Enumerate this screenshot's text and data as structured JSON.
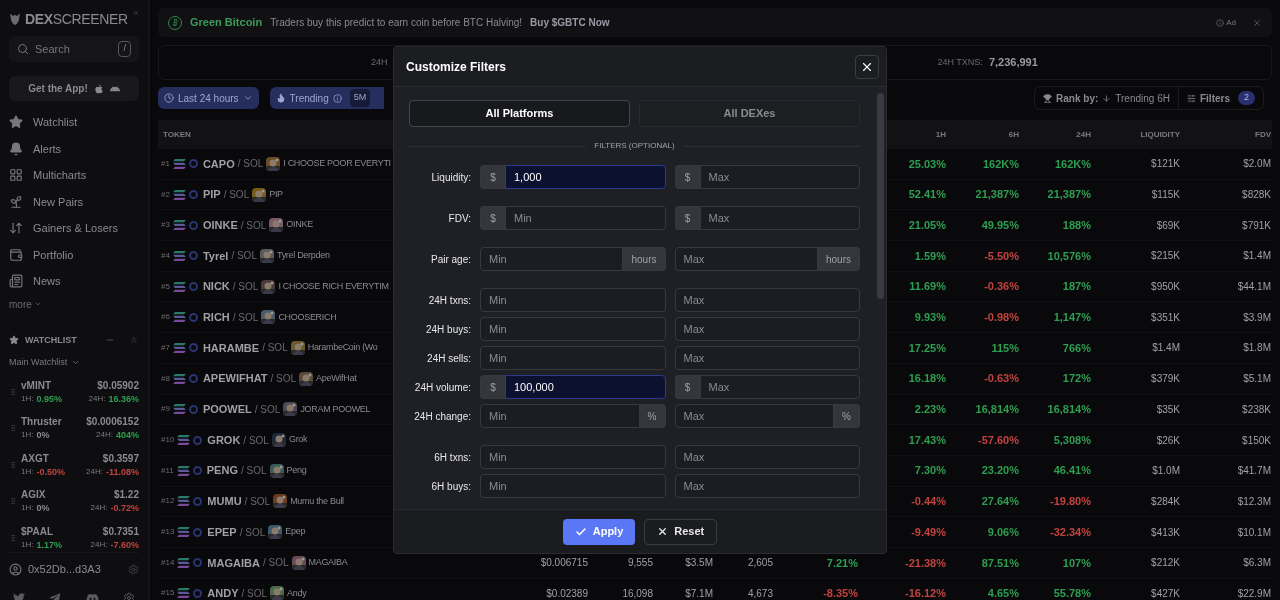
{
  "sidebar": {
    "logo": {
      "bold": "DEX",
      "light": "SCREENER"
    },
    "search": {
      "placeholder": "Search",
      "shortcut": "/"
    },
    "app_button": "Get the App!",
    "nav": [
      {
        "label": "Watchlist"
      },
      {
        "label": "Alerts"
      },
      {
        "label": "Multicharts"
      },
      {
        "label": "New Pairs"
      },
      {
        "label": "Gainers & Losers"
      },
      {
        "label": "Portfolio"
      },
      {
        "label": "News"
      }
    ],
    "more": "more",
    "watchlist": {
      "title": "WATCHLIST",
      "list_name": "Main Watchlist",
      "items": [
        {
          "symbol": "vMINT",
          "price": "$0.05902",
          "h1": {
            "label": "1H:",
            "value": "0.95%",
            "color": "#2e9e50"
          },
          "h24": {
            "label": "24H:",
            "value": "16.36%",
            "color": "#2e9e50"
          }
        },
        {
          "symbol": "Thruster",
          "price": "$0.0006152",
          "h1": {
            "label": "1H:",
            "value": "0%",
            "color": "#8a8a90"
          },
          "h24": {
            "label": "24H:",
            "value": "404%",
            "color": "#2e9e50"
          }
        },
        {
          "symbol": "AXGT",
          "price": "$0.3597",
          "h1": {
            "label": "1H:",
            "value": "-0.50%",
            "color": "#c0433f"
          },
          "h24": {
            "label": "24H:",
            "value": "-11.08%",
            "color": "#c0433f"
          }
        },
        {
          "symbol": "AGIX",
          "price": "$1.22",
          "h1": {
            "label": "1H:",
            "value": "0%",
            "color": "#8a8a90"
          },
          "h24": {
            "label": "24H:",
            "value": "-0.72%",
            "color": "#c0433f"
          }
        },
        {
          "symbol": "$PAAL",
          "price": "$0.7351",
          "h1": {
            "label": "1H:",
            "value": "1.17%",
            "color": "#2e9e50"
          },
          "h24": {
            "label": "24H:",
            "value": "-7.60%",
            "color": "#c0433f"
          }
        }
      ]
    },
    "wallet": "0x52Db...d3A3"
  },
  "ad": {
    "brand": "Green Bitcoin",
    "text": "Traders buy this predict to earn coin before BTC Halving!",
    "cta": "Buy $GBTC Now",
    "tag": "Ad"
  },
  "stats": [
    {
      "label": "24H"
    },
    {
      "label": "24H TXNS:",
      "value": "7,236,991"
    }
  ],
  "toolbar": {
    "timeframe": "Last 24 hours",
    "trending": "Trending",
    "trending_window": "5M",
    "rank_label": "Rank by:",
    "rank_value": "Trending 6H",
    "filters": "Filters",
    "filters_count": "2"
  },
  "table": {
    "columns": [
      {
        "label": "TOKEN"
      },
      {
        "label": "1H"
      },
      {
        "label": "6H"
      },
      {
        "label": "24H"
      },
      {
        "label": "LIQUIDITY"
      },
      {
        "label": "FDV"
      }
    ],
    "rows": [
      {
        "rank": "#1",
        "symbol": "CAPO",
        "quote": "/ SOL",
        "name": "I CHOOSE POOR EVERYTI",
        "h1": {
          "value": "25.03%",
          "color": "#2e9e50"
        },
        "h6": {
          "value": "162K%",
          "color": "#2e9e50"
        },
        "h24": {
          "value": "162K%",
          "color": "#2e9e50"
        },
        "liquidity": "$121K",
        "fdv": "$2.0M"
      },
      {
        "rank": "#2",
        "symbol": "PIP",
        "quote": "/ SOL",
        "name": "PIP",
        "h1": {
          "value": "52.41%",
          "color": "#2e9e50"
        },
        "h6": {
          "value": "21,387%",
          "color": "#2e9e50"
        },
        "h24": {
          "value": "21,387%",
          "color": "#2e9e50"
        },
        "liquidity": "$115K",
        "fdv": "$828K"
      },
      {
        "rank": "#3",
        "symbol": "OINKE",
        "quote": "/ SOL",
        "name": "OINKE",
        "h1": {
          "value": "21.05%",
          "color": "#2e9e50"
        },
        "h6": {
          "value": "49.95%",
          "color": "#2e9e50"
        },
        "h24": {
          "value": "188%",
          "color": "#2e9e50"
        },
        "liquidity": "$69K",
        "fdv": "$791K"
      },
      {
        "rank": "#4",
        "symbol": "Tyrel",
        "quote": "/ SOL",
        "name": "Tyrel Derpden",
        "h1": {
          "value": "1.59%",
          "color": "#2e9e50"
        },
        "h6": {
          "value": "-5.50%",
          "color": "#c0433f"
        },
        "h24": {
          "value": "10,576%",
          "color": "#2e9e50"
        },
        "liquidity": "$215K",
        "fdv": "$1.4M"
      },
      {
        "rank": "#5",
        "symbol": "NICK",
        "quote": "/ SOL",
        "name": "I CHOOSE RICH EVERYTIM",
        "h1": {
          "value": "11.69%",
          "color": "#2e9e50"
        },
        "h6": {
          "value": "-0.36%",
          "color": "#c0433f"
        },
        "h24": {
          "value": "187%",
          "color": "#2e9e50"
        },
        "liquidity": "$950K",
        "fdv": "$44.1M"
      },
      {
        "rank": "#6",
        "symbol": "RICH",
        "quote": "/ SOL",
        "name": "CHOOSERICH",
        "h1": {
          "value": "9.93%",
          "color": "#2e9e50"
        },
        "h6": {
          "value": "-0.98%",
          "color": "#c0433f"
        },
        "h24": {
          "value": "1,147%",
          "color": "#2e9e50"
        },
        "liquidity": "$351K",
        "fdv": "$3.9M"
      },
      {
        "rank": "#7",
        "symbol": "HARAMBE",
        "quote": "/ SOL",
        "name": "HarambeCoin (Wo",
        "h1": {
          "value": "17.25%",
          "color": "#2e9e50"
        },
        "h6": {
          "value": "115%",
          "color": "#2e9e50"
        },
        "h24": {
          "value": "766%",
          "color": "#2e9e50"
        },
        "liquidity": "$1.4M",
        "fdv": "$1.8M"
      },
      {
        "rank": "#8",
        "symbol": "APEWIFHAT",
        "quote": "/ SOL",
        "name": "ApeWifHat",
        "h1": {
          "value": "16.18%",
          "color": "#2e9e50"
        },
        "h6": {
          "value": "-0.63%",
          "color": "#c0433f"
        },
        "h24": {
          "value": "172%",
          "color": "#2e9e50"
        },
        "liquidity": "$379K",
        "fdv": "$5.1M"
      },
      {
        "rank": "#9",
        "symbol": "POOWEL",
        "quote": "/ SOL",
        "name": "JORAM POOWEL",
        "h1": {
          "value": "2.23%",
          "color": "#2e9e50"
        },
        "h6": {
          "value": "16,814%",
          "color": "#2e9e50"
        },
        "h24": {
          "value": "16,814%",
          "color": "#2e9e50"
        },
        "liquidity": "$35K",
        "fdv": "$238K"
      },
      {
        "rank": "#10",
        "symbol": "GROK",
        "quote": "/ SOL",
        "name": "Grok",
        "h1": {
          "value": "17.43%",
          "color": "#2e9e50"
        },
        "h6": {
          "value": "-57.60%",
          "color": "#c0433f"
        },
        "h24": {
          "value": "5,308%",
          "color": "#2e9e50"
        },
        "liquidity": "$26K",
        "fdv": "$150K"
      },
      {
        "rank": "#11",
        "symbol": "PENG",
        "quote": "/ SOL",
        "name": "Peng",
        "h1": {
          "value": "7.30%",
          "color": "#2e9e50"
        },
        "h6": {
          "value": "23.20%",
          "color": "#2e9e50"
        },
        "h24": {
          "value": "46.41%",
          "color": "#2e9e50"
        },
        "liquidity": "$1.0M",
        "fdv": "$41.7M"
      },
      {
        "rank": "#12",
        "symbol": "MUMU",
        "quote": "/ SOL",
        "name": "Mumu the Bull",
        "h1": {
          "value": "-0.44%",
          "color": "#c0433f"
        },
        "h6": {
          "value": "27.64%",
          "color": "#2e9e50"
        },
        "h24": {
          "value": "-19.80%",
          "color": "#c0433f"
        },
        "liquidity": "$284K",
        "fdv": "$12.3M"
      },
      {
        "rank": "#13",
        "symbol": "EPEP",
        "quote": "/ SOL",
        "name": "Epep",
        "h1": {
          "value": "-9.49%",
          "color": "#c0433f"
        },
        "h6": {
          "value": "9.06%",
          "color": "#2e9e50"
        },
        "h24": {
          "value": "-32.34%",
          "color": "#c0433f"
        },
        "liquidity": "$413K",
        "fdv": "$10.1M"
      },
      {
        "rank": "#14",
        "symbol": "MAGAIBA",
        "quote": "/ SOL",
        "name": "MAGAIBA",
        "price": "$0.006715",
        "txns": "9,555",
        "volume": "$3.5M",
        "makers": "2,605",
        "m5": {
          "value": "7.21%",
          "color": "#2e9e50"
        },
        "h1": {
          "value": "-21.38%",
          "color": "#c0433f"
        },
        "h6": {
          "value": "87.51%",
          "color": "#2e9e50"
        },
        "h24": {
          "value": "107%",
          "color": "#2e9e50"
        },
        "liquidity": "$212K",
        "fdv": "$6.3M"
      },
      {
        "rank": "#15",
        "symbol": "ANDY",
        "quote": "/ SOL",
        "name": "Andy",
        "price": "$0.02389",
        "txns": "16,098",
        "volume": "$7.1M",
        "makers": "4,673",
        "m5": {
          "value": "-8.35%",
          "color": "#c0433f"
        },
        "h1": {
          "value": "-16.12%",
          "color": "#c0433f"
        },
        "h6": {
          "value": "4.65%",
          "color": "#2e9e50"
        },
        "h24": {
          "value": "55.78%",
          "color": "#2e9e50"
        },
        "liquidity": "$427K",
        "fdv": "$22.9M"
      }
    ]
  },
  "modal": {
    "title": "Customize Filters",
    "tabs": [
      {
        "label": "All Platforms",
        "selected": true
      },
      {
        "label": "All DEXes",
        "selected": false
      }
    ],
    "section": "FILTERS (OPTIONAL)",
    "groups": [
      [
        {
          "label": "Liquidity:",
          "min": {
            "prefix": "$",
            "value": "1,000",
            "active": true
          },
          "max": {
            "prefix": "$",
            "placeholder": "Max",
            "active": false
          }
        }
      ],
      [
        {
          "label": "FDV:",
          "min": {
            "prefix": "$",
            "placeholder": "Min",
            "active": false
          },
          "max": {
            "prefix": "$",
            "placeholder": "Max",
            "active": false
          }
        }
      ],
      [
        {
          "label": "Pair age:",
          "min": {
            "suffix": "hours",
            "placeholder": "Min",
            "active": false
          },
          "max": {
            "suffix": "hours",
            "placeholder": "Max",
            "active": false
          }
        }
      ],
      [
        {
          "label": "24H txns:",
          "min": {
            "placeholder": "Min",
            "active": false
          },
          "max": {
            "placeholder": "Max",
            "active": false
          }
        },
        {
          "label": "24H buys:",
          "min": {
            "placeholder": "Min",
            "active": false
          },
          "max": {
            "placeholder": "Max",
            "active": false
          }
        },
        {
          "label": "24H sells:",
          "min": {
            "placeholder": "Min",
            "active": false
          },
          "max": {
            "placeholder": "Max",
            "active": false
          }
        },
        {
          "label": "24H volume:",
          "min": {
            "prefix": "$",
            "value": "100,000",
            "active": true
          },
          "max": {
            "prefix": "$",
            "placeholder": "Max",
            "active": false
          }
        },
        {
          "label": "24H change:",
          "min": {
            "suffix": "%",
            "placeholder": "Min",
            "active": false
          },
          "max": {
            "suffix": "%",
            "placeholder": "Max",
            "active": false
          }
        }
      ],
      [
        {
          "label": "6H txns:",
          "min": {
            "placeholder": "Min",
            "active": false
          },
          "max": {
            "placeholder": "Max",
            "active": false
          }
        },
        {
          "label": "6H buys:",
          "min": {
            "placeholder": "Min",
            "active": false
          },
          "max": {
            "placeholder": "Max",
            "active": false
          }
        }
      ]
    ],
    "buttons": [
      {
        "label": "Apply",
        "kind": "primary"
      },
      {
        "label": "Reset",
        "kind": "secondary"
      }
    ]
  }
}
